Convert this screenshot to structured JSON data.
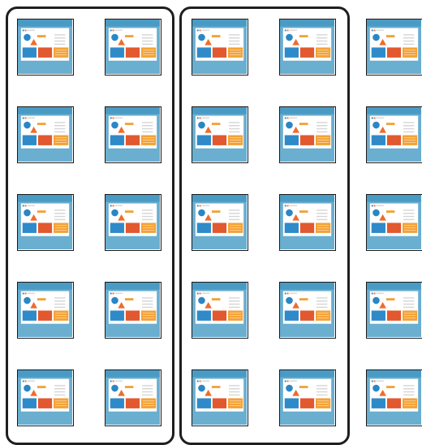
{
  "colors": {
    "frame": "#6aaed0",
    "titlebar": "#4a9bc4",
    "paper": "#ffffff",
    "circle": "#2a86c5",
    "triangle": "#ee6c2c",
    "dash": "#f1a33b",
    "text_line": "#d6d6d6",
    "card_blue": "#2f8ac9",
    "card_red": "#e2582f",
    "card_orange": "#f4a235",
    "group_border": "#1f1f1f"
  },
  "grid": {
    "rows": 5,
    "columns": 5,
    "thumbnail_icon": "slide-thumbnail-icon"
  },
  "groups": [
    {
      "name": "group-1",
      "columns": [
        1,
        2
      ]
    },
    {
      "name": "group-2",
      "columns": [
        3,
        4
      ]
    }
  ]
}
